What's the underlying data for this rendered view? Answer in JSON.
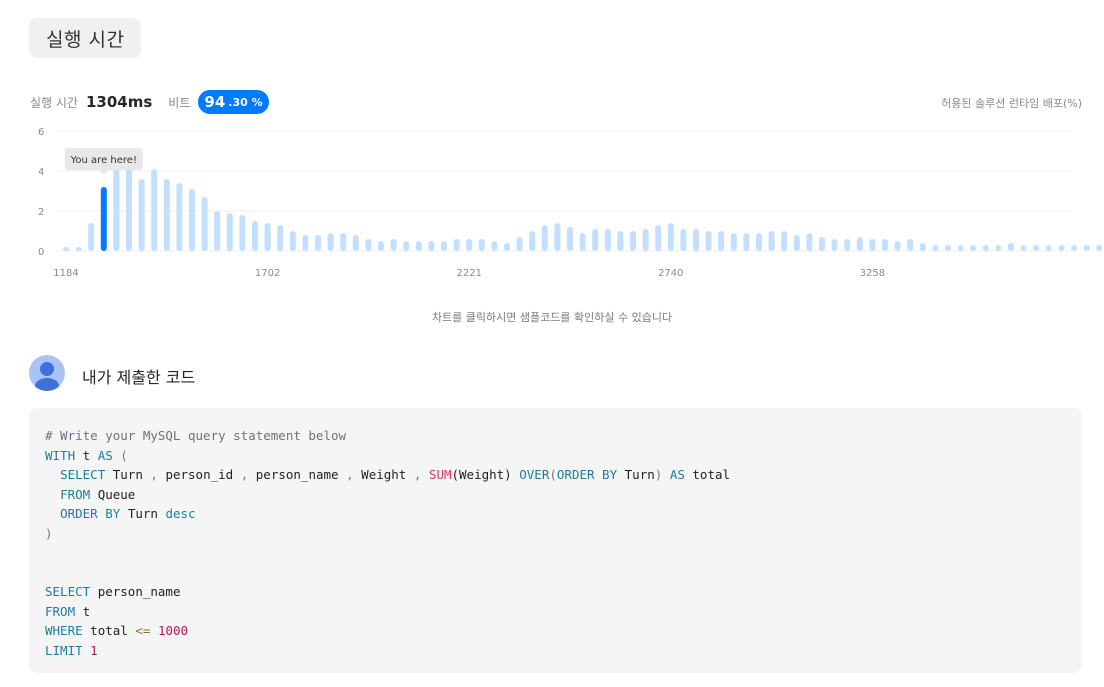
{
  "tab": {
    "label": "실행 시간"
  },
  "stats": {
    "runtime_label": "실행 시간",
    "runtime_value": "1304ms",
    "beat_label": "비트",
    "beat_int": "94",
    "beat_decimal": ".30 %"
  },
  "distribution_title": "허용된 솔루션 런타임 배포(%)",
  "chart_data": {
    "type": "bar",
    "ylim": [
      0,
      6
    ],
    "y_ticks": [
      "0",
      "2",
      "4",
      "6"
    ],
    "x_tick_labels": [
      {
        "index": 0,
        "label": "1184"
      },
      {
        "index": 16,
        "label": "1702"
      },
      {
        "index": 32,
        "label": "2221"
      },
      {
        "index": 48,
        "label": "2740"
      },
      {
        "index": 64,
        "label": "3258"
      }
    ],
    "values": [
      0.2,
      0.2,
      1.4,
      3.2,
      4.2,
      4.2,
      3.6,
      4.1,
      3.6,
      3.4,
      3.1,
      2.7,
      2.0,
      1.9,
      1.8,
      1.5,
      1.4,
      1.3,
      1.0,
      0.8,
      0.8,
      0.9,
      0.9,
      0.8,
      0.6,
      0.5,
      0.6,
      0.5,
      0.5,
      0.5,
      0.5,
      0.6,
      0.6,
      0.6,
      0.5,
      0.4,
      0.7,
      1.0,
      1.3,
      1.4,
      1.2,
      0.9,
      1.1,
      1.1,
      1.0,
      1.0,
      1.1,
      1.3,
      1.4,
      1.1,
      1.1,
      1.0,
      1.0,
      0.9,
      0.9,
      0.9,
      1.0,
      1.0,
      0.8,
      0.9,
      0.7,
      0.6,
      0.6,
      0.7,
      0.6,
      0.6,
      0.5,
      0.6,
      0.4,
      0.3,
      0.3,
      0.3,
      0.3,
      0.3,
      0.3,
      0.4,
      0.3,
      0.3,
      0.3,
      0.3,
      0.3,
      0.3,
      0.3,
      0.3
    ],
    "highlight_index": 3,
    "highlight_color": "#007aff",
    "bar_color": "#c2e0fd",
    "tooltip": "You are here!",
    "grid": true
  },
  "chart_hint": "차트를 클릭하시면 샘플코드를 확인하실 수 있습니다",
  "submission": {
    "avatar_icon": "user-avatar-icon",
    "title": "내가 제출한 코드",
    "code": {
      "comment": "# Write your MySQL query statement below",
      "with_kw": "WITH",
      "t1": "t",
      "as_kw": "AS",
      "lparen": "(",
      "select_kw": "SELECT",
      "col_turn": "Turn",
      "comma1": ",",
      "col_pid": "person_id",
      "comma2": ",",
      "col_pname": "person_name",
      "comma3": ",",
      "col_weight": "Weight",
      "comma4": ",",
      "sum_fn": "SUM",
      "sum_arg": "(Weight)",
      "over_kw": "OVER",
      "over_lp": "(",
      "orderby_kw1": "ORDER BY",
      "over_col": "Turn",
      "over_rp": ")",
      "as_kw2": "AS",
      "alias_total": "total",
      "from_kw": "FROM",
      "tbl_queue": "Queue",
      "orderby_kw2": "ORDER BY",
      "ord_col": "Turn",
      "desc_kw": "desc",
      "rparen": ")",
      "select_kw2": "SELECT",
      "sel_col": "person_name",
      "from_kw2": "FROM",
      "tbl_t": "t",
      "where_kw": "WHERE",
      "where_col": "total",
      "lte": "<=",
      "num_1000": "1000",
      "limit_kw": "LIMIT",
      "num_1": "1"
    }
  }
}
